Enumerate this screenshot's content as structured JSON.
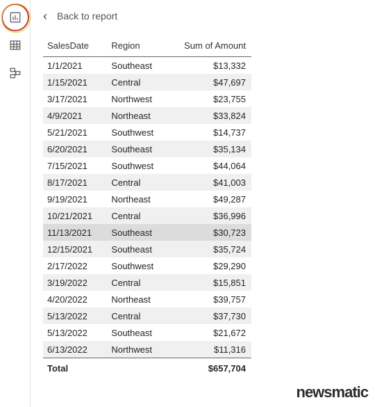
{
  "sidebar": {
    "icons": [
      {
        "name": "report-view-icon"
      },
      {
        "name": "data-view-icon"
      },
      {
        "name": "model-view-icon"
      }
    ]
  },
  "header": {
    "back_label": "Back to report"
  },
  "table": {
    "columns": [
      "SalesDate",
      "Region",
      "Sum of Amount"
    ],
    "rows": [
      {
        "date": "1/1/2021",
        "region": "Southeast",
        "amount": "$13,332",
        "alt": false
      },
      {
        "date": "1/15/2021",
        "region": "Central",
        "amount": "$47,697",
        "alt": true
      },
      {
        "date": "3/17/2021",
        "region": "Northwest",
        "amount": "$23,755",
        "alt": false
      },
      {
        "date": "4/9/2021",
        "region": "Northeast",
        "amount": "$33,824",
        "alt": true
      },
      {
        "date": "5/21/2021",
        "region": "Southwest",
        "amount": "$14,737",
        "alt": false
      },
      {
        "date": "6/20/2021",
        "region": "Southeast",
        "amount": "$35,134",
        "alt": true
      },
      {
        "date": "7/15/2021",
        "region": "Southwest",
        "amount": "$44,064",
        "alt": false
      },
      {
        "date": "8/17/2021",
        "region": "Central",
        "amount": "$41,003",
        "alt": true
      },
      {
        "date": "9/19/2021",
        "region": "Northeast",
        "amount": "$49,287",
        "alt": false
      },
      {
        "date": "10/21/2021",
        "region": "Central",
        "amount": "$36,996",
        "alt": true
      },
      {
        "date": "11/13/2021",
        "region": "Southeast",
        "amount": "$30,723",
        "alt": false,
        "sel": true
      },
      {
        "date": "12/15/2021",
        "region": "Southeast",
        "amount": "$35,724",
        "alt": true
      },
      {
        "date": "2/17/2022",
        "region": "Southwest",
        "amount": "$29,290",
        "alt": false
      },
      {
        "date": "3/19/2022",
        "region": "Central",
        "amount": "$15,851",
        "alt": true
      },
      {
        "date": "4/20/2022",
        "region": "Northeast",
        "amount": "$39,757",
        "alt": false
      },
      {
        "date": "5/13/2022",
        "region": "Central",
        "amount": "$37,730",
        "alt": true
      },
      {
        "date": "5/13/2022",
        "region": "Southeast",
        "amount": "$21,672",
        "alt": false
      },
      {
        "date": "6/13/2022",
        "region": "Northwest",
        "amount": "$11,316",
        "alt": true
      }
    ],
    "footer": {
      "label": "Total",
      "amount": "$657,704"
    }
  },
  "watermark": "newsmatic"
}
